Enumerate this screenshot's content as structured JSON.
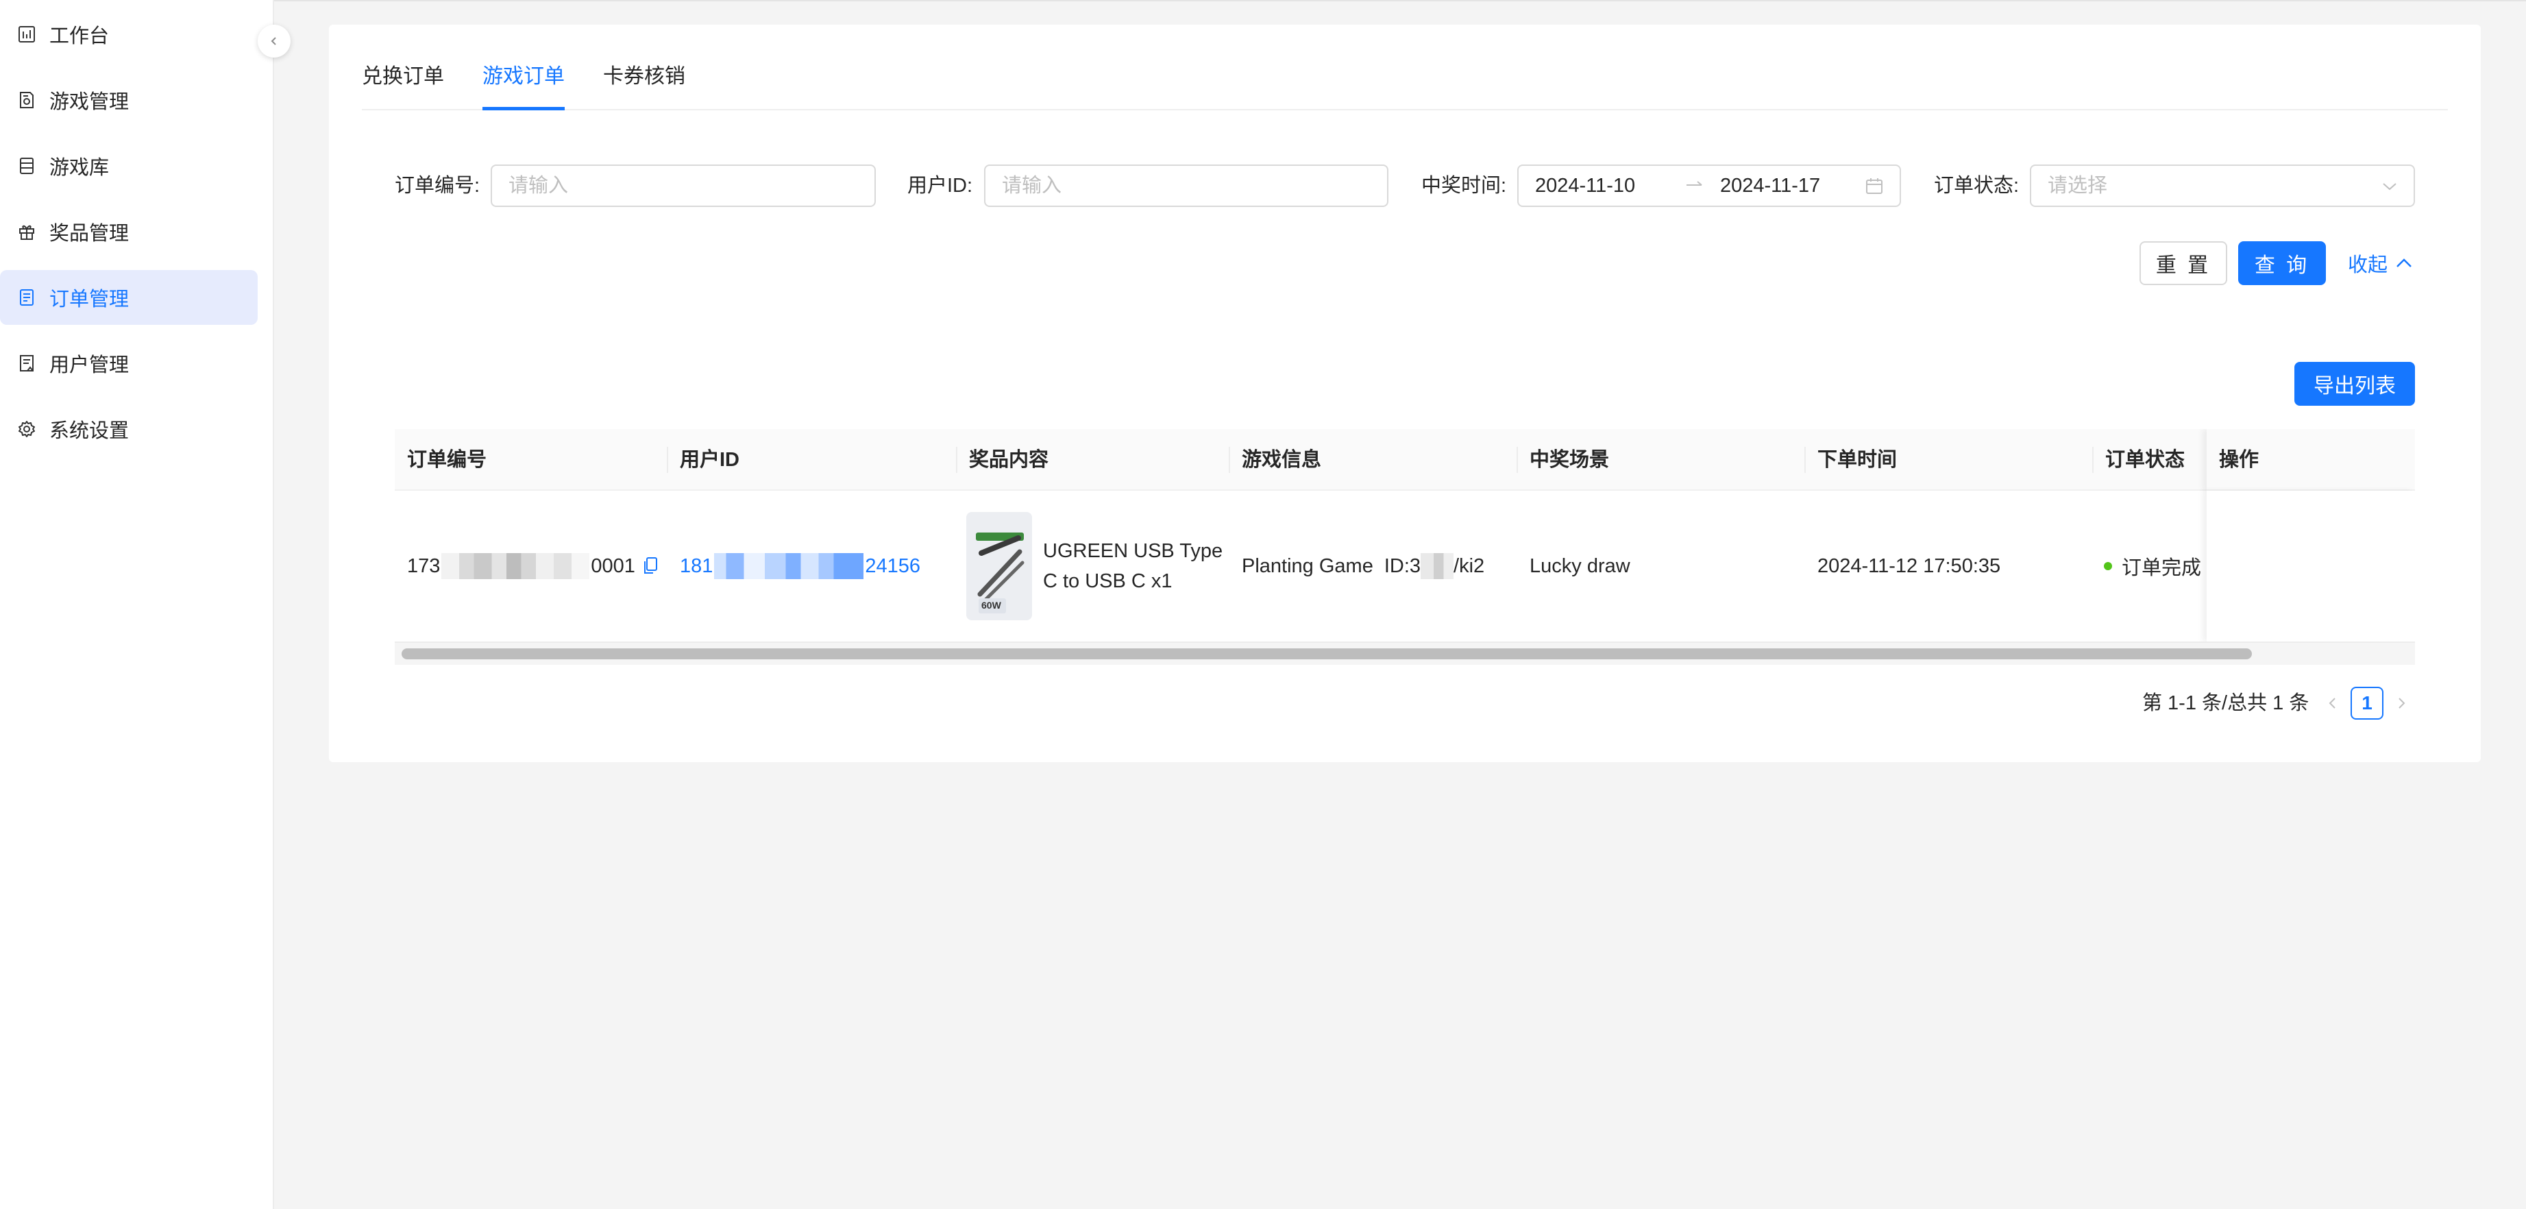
{
  "sidebar": {
    "items": [
      {
        "label": "工作台",
        "icon": "dashboard-icon",
        "active": false
      },
      {
        "label": "游戏管理",
        "icon": "game-manage-icon",
        "active": false
      },
      {
        "label": "游戏库",
        "icon": "library-icon",
        "active": false
      },
      {
        "label": "奖品管理",
        "icon": "gift-icon",
        "active": false
      },
      {
        "label": "订单管理",
        "icon": "order-icon",
        "active": true
      },
      {
        "label": "用户管理",
        "icon": "user-icon",
        "active": false
      },
      {
        "label": "系统设置",
        "icon": "gear-icon",
        "active": false
      }
    ],
    "collapse_icon": "chevron-left-icon"
  },
  "tabs": [
    {
      "label": "兑换订单",
      "active": false
    },
    {
      "label": "游戏订单",
      "active": true
    },
    {
      "label": "卡券核销",
      "active": false
    }
  ],
  "filters": {
    "order_no": {
      "label": "订单编号:",
      "placeholder": "请输入"
    },
    "user_id": {
      "label": "用户ID:",
      "placeholder": "请输入"
    },
    "win_time": {
      "label": "中奖时间:",
      "start": "2024-11-10",
      "end": "2024-11-17",
      "separator_icon": "arrow-right-icon",
      "calendar_icon": "calendar-icon"
    },
    "status": {
      "label": "订单状态:",
      "placeholder": "请选择",
      "dropdown_icon": "chevron-down-icon"
    }
  },
  "actions": {
    "reset": "重 置",
    "search": "查 询",
    "collapse": "收起",
    "export": "导出列表"
  },
  "table": {
    "columns": [
      "订单编号",
      "用户ID",
      "奖品内容",
      "游戏信息",
      "中奖场景",
      "下单时间",
      "订单状态",
      "操作"
    ],
    "rows": [
      {
        "order_no_prefix": "173",
        "order_no_suffix": "0001",
        "user_id_prefix": "181",
        "user_id_suffix": "24156",
        "prize": "UGREEN USB Type C to USB C x1",
        "prize_line1": "UGREEN USB Type",
        "prize_line2": "C to USB C x1",
        "prize_badge": "60W",
        "game_name": "Planting Game",
        "game_id_prefix": "ID:3",
        "game_id_suffix": "/ki2",
        "scene": "Lucky draw",
        "time": "2024-11-12 17:50:35",
        "status": "订单完成",
        "status_color": "#52c41a"
      }
    ]
  },
  "pagination": {
    "summary": "第 1-1 条/总共 1 条",
    "current_page": "1"
  },
  "colors": {
    "primary": "#1677ff",
    "active_nav_bg": "#e6ebfd",
    "success": "#52c41a"
  }
}
